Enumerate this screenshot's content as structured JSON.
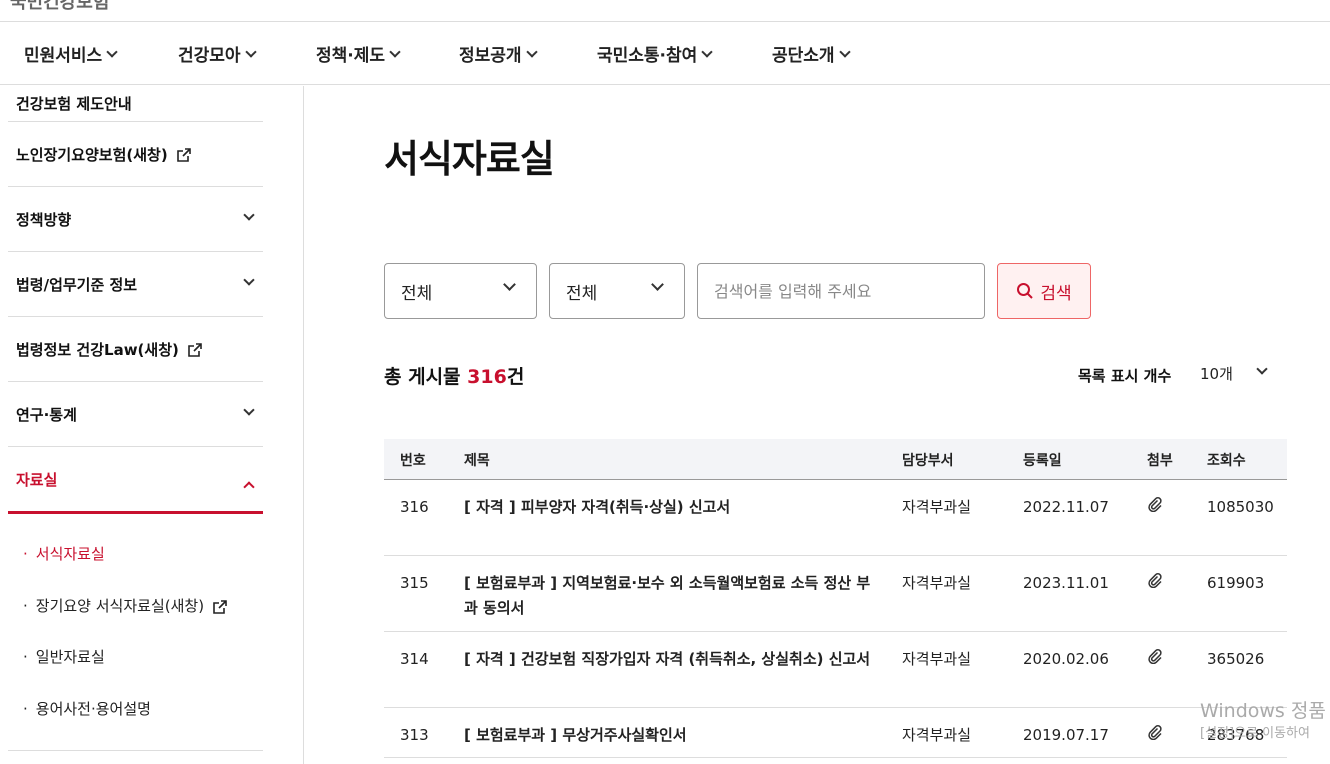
{
  "site": {
    "logo_text": "국민건강보험"
  },
  "gnb": {
    "items": [
      {
        "label": "민원서비스"
      },
      {
        "label": "건강모아"
      },
      {
        "label": "정책·제도"
      },
      {
        "label": "정보공개"
      },
      {
        "label": "국민소통·참여"
      },
      {
        "label": "공단소개"
      }
    ]
  },
  "sidebar": {
    "cut_item": "건강보험 제도안내",
    "items": [
      {
        "label": "노인장기요양보험(새창)"
      },
      {
        "label": "정책방향"
      },
      {
        "label": "법령/업무기준 정보"
      },
      {
        "label": "법령정보 건강Law(새창)"
      },
      {
        "label": "연구·통계"
      },
      {
        "label": "자료실"
      }
    ],
    "subitems": [
      {
        "label": "서식자료실"
      },
      {
        "label": "장기요양 서식자료실(새창)"
      },
      {
        "label": "일반자료실"
      },
      {
        "label": "용어사전·용어설명"
      }
    ],
    "bullet": "·"
  },
  "page": {
    "title": "서식자료실"
  },
  "search": {
    "select1": "전체",
    "select2": "전체",
    "placeholder": "검색어를 입력해 주세요",
    "button": "검색"
  },
  "summary": {
    "prefix": "총 게시물 ",
    "count": "316",
    "suffix": "건",
    "perpage_label": "목록 표시 개수",
    "perpage_value": "10개"
  },
  "table": {
    "headers": {
      "no": "번호",
      "title": "제목",
      "dept": "담당부서",
      "date": "등록일",
      "attach": "첨부",
      "views": "조회수"
    },
    "rows": [
      {
        "no": "316",
        "title": "[ 자격 ] 피부양자 자격(취득·상실) 신고서",
        "dept": "자격부과실",
        "date": "2022.11.07",
        "views": "1085030"
      },
      {
        "no": "315",
        "title": "[ 보험료부과 ] 지역보험료·보수 외 소득월액보험료 소득 정산 부과 동의서",
        "dept": "자격부과실",
        "date": "2023.11.01",
        "views": "619903"
      },
      {
        "no": "314",
        "title": "[ 자격 ] 건강보험 직장가입자 자격 (취득취소, 상실취소) 신고서",
        "dept": "자격부과실",
        "date": "2020.02.06",
        "views": "365026"
      },
      {
        "no": "313",
        "title": "[ 보험료부과 ] 무상거주사실확인서",
        "dept": "자격부과실",
        "date": "2019.07.17",
        "views": "283768"
      }
    ]
  },
  "os": {
    "watermark1": "Windows 정품",
    "watermark2": "[설정]으로 이동하여"
  },
  "colors": {
    "accent": "#c8102e",
    "border": "#dddddd",
    "table_head_bg": "#f3f4f7"
  }
}
